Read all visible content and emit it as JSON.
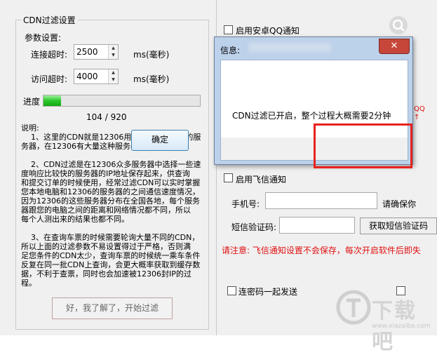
{
  "cdn_panel": {
    "group_title": "CDN过滤设置",
    "params_label": "参数设置:",
    "connect_timeout_label": "连接超时:",
    "connect_timeout_value": "2500",
    "connect_timeout_unit": "ms(毫秒)",
    "access_timeout_label": "访问超时:",
    "access_timeout_value": "4000",
    "access_timeout_unit": "ms(毫秒)",
    "progress_label": "进度",
    "progress_count": "104 / 920",
    "progress_fraction": 0.113,
    "notes": "说明:\n    1、这里的CDN就是12306用来缓存各类数据的服\n务器，在12306有大量这种服务器。\n\n    2、CDN过滤是在12306众多服务器中选择一些速\n度响应比较快的服务器的IP地址保存起来，供查询\n和提交订单的时候使用，经常过滤CDN可以实时掌握\n您本地电脑和12306的服务器的之间通信速度情况，\n因为12306的这些服务器分布在全国各地，每个服务\n器跟您的电脑之间的距离和网络情况都不同，所以\n每个人测出来的结果也都不同。\n\n    3、在查询车票的时候需要轮询大量不同的CDN，\n所以上面的过滤参数不易设置得过于严格，否则满\n足您条件的CDN太少，查询车票的时候统一乘车条件\n反复在同一批CDN上查询，会更大概率获取到缓存数\n据，不利于查票，同时也会加速被12306封IP的过\n程。",
    "start_button": "好，我了解了，开始过滤"
  },
  "right_panel": {
    "android_qq_label": "启用安卓QQ通知",
    "fetion_label": "启用飞信通知",
    "phone_label": "手机号:",
    "confirm_hint": "请确保你",
    "sms_code_label": "短信验证码:",
    "get_sms_code_button": "获取短信验证码",
    "warning_text": "请注意: 飞信通知设置不会保存，每次开启软件后即失",
    "send_with_password_label": "连密码一起发送"
  },
  "dialog": {
    "title": "信息:",
    "message": "CDN过滤已开启，整个过程大概需要2分钟",
    "ok_button": "确定",
    "close_glyph": "✕"
  },
  "watermark": {
    "text": "下载吧",
    "url": "www.xiazaiba.com"
  },
  "colors": {
    "highlight": "#e8221d",
    "progress": "#2cc72c",
    "warning": "#e01010"
  }
}
